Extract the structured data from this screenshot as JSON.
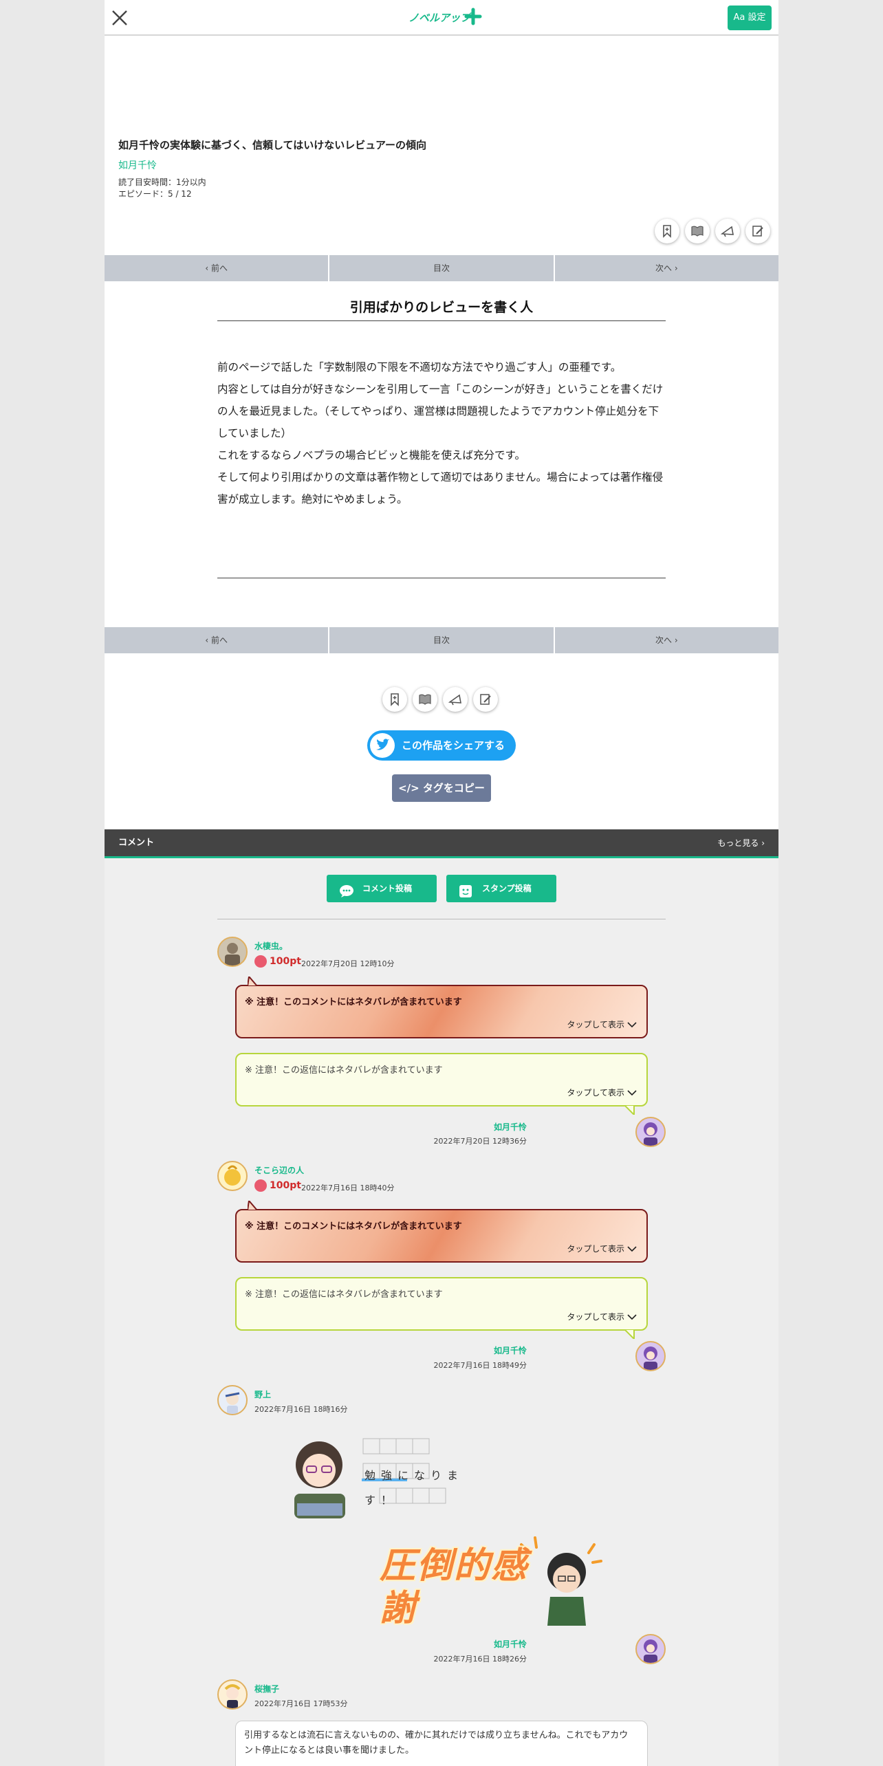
{
  "header": {
    "logo_text": "ノベルアップ+",
    "settings_label": "Aa 設定"
  },
  "work": {
    "title": "如月千怜の実体験に基づく、信頼してはいけないレビュアーの傾向",
    "author": "如月千怜",
    "reading_time": "読了目安時間：1分以内",
    "episode": "エピソード：5 / 12"
  },
  "nav": {
    "prev": "前へ",
    "toc": "目次",
    "next": "次へ"
  },
  "episode": {
    "title": "引用ばかりのレビューを書く人",
    "paragraphs": [
      "前のページで話した「字数制限の下限を不適切な方法でやり過ごす人」の亜種です。",
      "内容としては自分が好きなシーンを引用して一言「このシーンが好き」ということを書くだけの人を最近見ました。（そしてやっぱり、運営様は問題視したようでアカウント停止処分を下していました）",
      "これをするならノベプラの場合ビビッと機能を使えば充分です。",
      "そして何より引用ばかりの文章は著作物として適切ではありません。場合によっては著作権侵害が成立します。絶対にやめましょう。"
    ]
  },
  "share": {
    "twitter_label": "この作品をシェアする",
    "copy_tag_label": "タグをコピー"
  },
  "comments": {
    "section_title": "コメント",
    "more_label": "もっと見る",
    "post_comment_label": "コメント投稿",
    "post_stamp_label": "スタンプ投稿",
    "spoiler_comment": "※ 注意！このコメントにはネタバレが含まれています",
    "spoiler_reply": "※ 注意！この返信にはネタバレが含まれています",
    "tap_to_show": "タップして表示",
    "threads": [
      {
        "user": "水棲虫。",
        "points": "100pt",
        "date": "2022年7月20日 12時10分",
        "reply_user": "如月千怜",
        "reply_date": "2022年7月20日 12時36分"
      },
      {
        "user": "そこら辺の人",
        "points": "100pt",
        "date": "2022年7月16日 18時40分",
        "reply_user": "如月千怜",
        "reply_date": "2022年7月16日 18時49分"
      },
      {
        "user": "野上",
        "date": "2022年7月16日 18時16分",
        "stamp_text": "勉強になります！",
        "reply_user": "如月千怜",
        "reply_date": "2022年7月16日 18時26分",
        "reply_stamp_text": "圧倒的感謝"
      },
      {
        "user": "桜撫子",
        "date": "2022年7月16日 17時53分",
        "text": "引用するなとは流石に言えないものの、確かに其れだけでは成り立ちませんね。これでもアカウント停止になるとは良い事を聞けました。"
      }
    ]
  },
  "colors": {
    "brand_green": "#18b98b",
    "twitter_blue": "#1da1f2",
    "nav_gray": "#c4c9d1",
    "spoiler_border": "#7a1a1a",
    "reply_border": "#b7d63c"
  }
}
